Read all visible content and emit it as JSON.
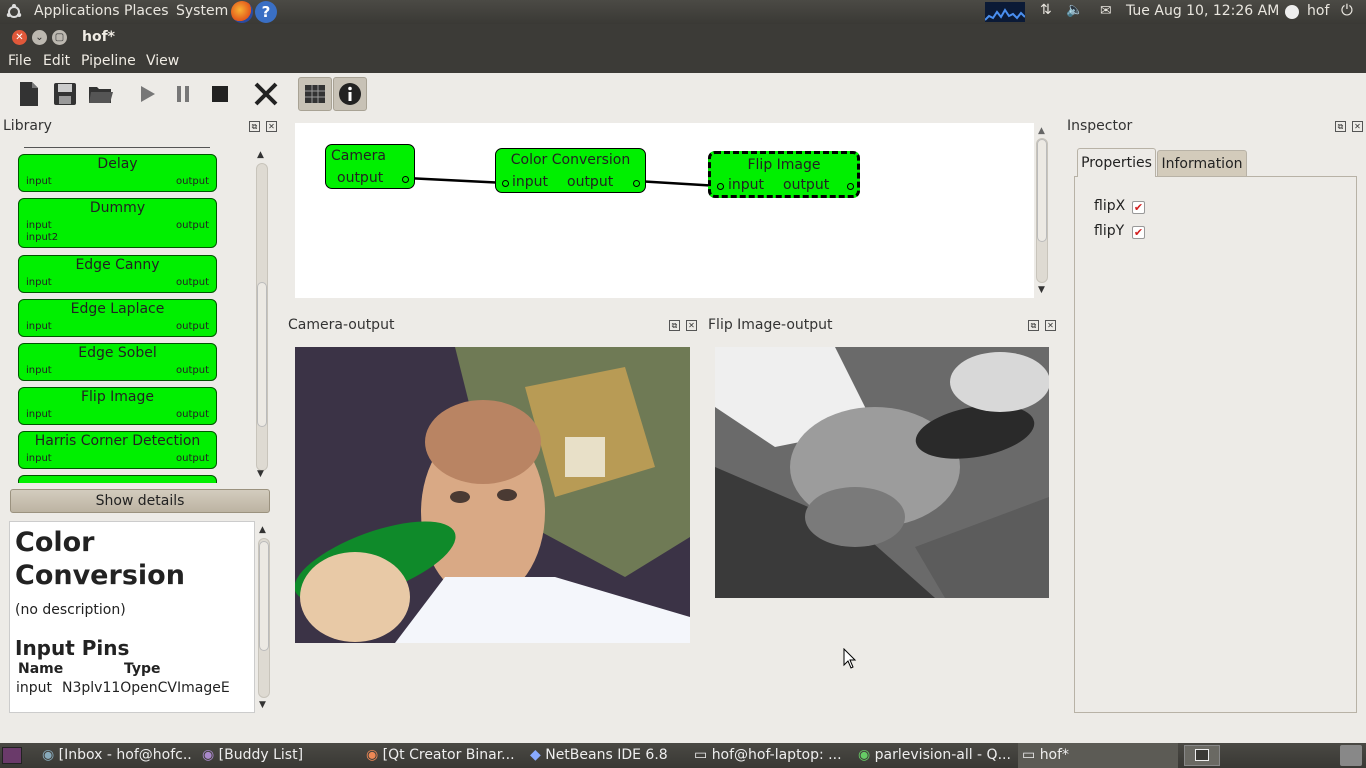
{
  "topbar": {
    "menus": [
      "Applications",
      "Places",
      "System"
    ],
    "datetime": "Tue Aug 10, 12:26 AM",
    "user": "hof"
  },
  "window": {
    "title": "hof*",
    "menu": [
      "File",
      "Edit",
      "Pipeline",
      "View"
    ]
  },
  "toolbar": {
    "icons": [
      "new-icon",
      "save-icon",
      "open-icon",
      "play-icon",
      "pause-icon",
      "stop-icon",
      "close-icon",
      "grid-icon",
      "info-icon"
    ]
  },
  "library": {
    "title": "Library",
    "items": [
      {
        "name": "Delay",
        "inputs": [
          "input"
        ],
        "outputs": [
          "output"
        ]
      },
      {
        "name": "Dummy",
        "inputs": [
          "input",
          "input2"
        ],
        "outputs": [
          "output"
        ]
      },
      {
        "name": "Edge Canny",
        "inputs": [
          "input"
        ],
        "outputs": [
          "output"
        ]
      },
      {
        "name": "Edge Laplace",
        "inputs": [
          "input"
        ],
        "outputs": [
          "output"
        ]
      },
      {
        "name": "Edge Sobel",
        "inputs": [
          "input"
        ],
        "outputs": [
          "output"
        ]
      },
      {
        "name": "Flip Image",
        "inputs": [
          "input"
        ],
        "outputs": [
          "output"
        ]
      },
      {
        "name": "Harris Corner Detection",
        "inputs": [
          "input"
        ],
        "outputs": [
          "output"
        ]
      }
    ],
    "show_details": "Show details"
  },
  "details": {
    "title": "Color Conversion",
    "description": "(no description)",
    "pins_heading": "Input Pins",
    "col_name": "Name",
    "col_type": "Type",
    "pin_name": "input",
    "pin_type": "N3plv11OpenCVImageE"
  },
  "pipeline": {
    "nodes": [
      {
        "name": "Camera",
        "inputs": [],
        "outputs": [
          "output"
        ]
      },
      {
        "name": "Color Conversion",
        "inputs": [
          "input"
        ],
        "outputs": [
          "output"
        ]
      },
      {
        "name": "Flip Image",
        "inputs": [
          "input"
        ],
        "outputs": [
          "output"
        ],
        "selected": true
      }
    ]
  },
  "viewers": [
    {
      "title": "Camera-output"
    },
    {
      "title": "Flip Image-output"
    }
  ],
  "inspector": {
    "title": "Inspector",
    "tabs": [
      "Properties",
      "Information"
    ],
    "active_tab": "Properties",
    "properties": [
      {
        "name": "flipX",
        "checked": true
      },
      {
        "name": "flipY",
        "checked": true
      }
    ]
  },
  "taskbar": {
    "tasks": [
      "[Inbox - hof@hofc...",
      "[Buddy List]",
      "[Qt Creator Binar...",
      "NetBeans IDE 6.8",
      "hof@hof-laptop: ...",
      "parlevision-all - Q...",
      "hof*"
    ]
  }
}
